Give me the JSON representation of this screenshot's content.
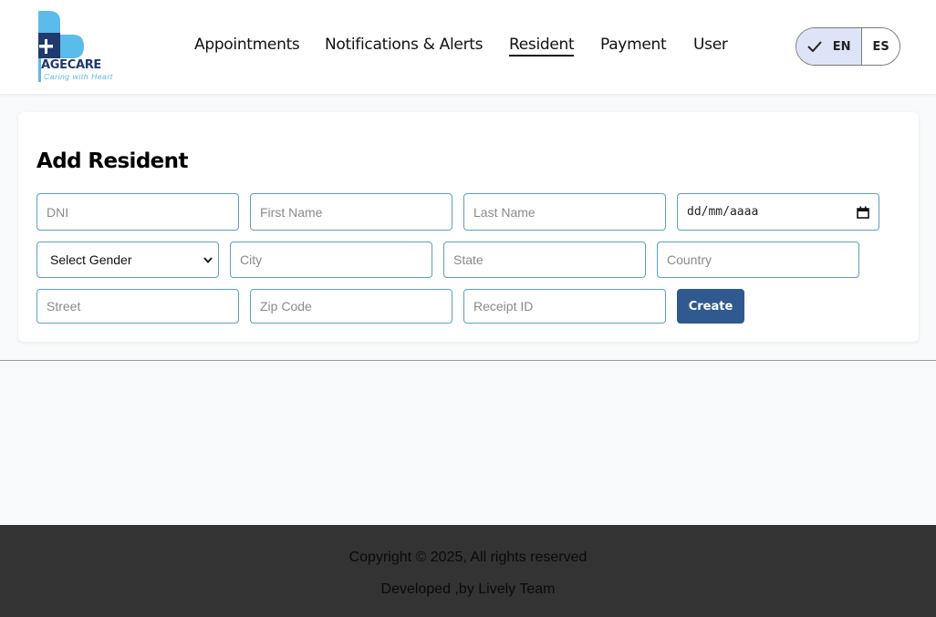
{
  "brand": {
    "name": "AGECARE",
    "tagline": "Caring with Heart",
    "colors": {
      "primary_blue": "#55b6e8",
      "navy": "#1e3a6e"
    }
  },
  "nav": {
    "items": [
      "Appointments",
      "Notifications & Alerts",
      "Resident",
      "Payment",
      "User"
    ],
    "active": "Resident"
  },
  "language": {
    "options": [
      "EN",
      "ES"
    ],
    "selected": "EN"
  },
  "form": {
    "title": "Add Resident",
    "placeholders": {
      "dni": "DNI",
      "first_name": "First Name",
      "last_name": "Last Name",
      "city": "City",
      "state": "State",
      "country": "Country",
      "street": "Street",
      "zip_code": "Zip Code",
      "receipt_id": "Receipt ID"
    },
    "date_placeholder": "dd/mm/aaaa",
    "gender_select": "Select Gender",
    "submit_label": "Create"
  },
  "footer": {
    "copyright": "Copyright © 2025, All rights reserved",
    "credit": "Developed ,by Lively Team"
  },
  "colors": {
    "accent_button": "#305a8f",
    "field_border": "#5aa0c9",
    "footer_bg": "#333333"
  }
}
